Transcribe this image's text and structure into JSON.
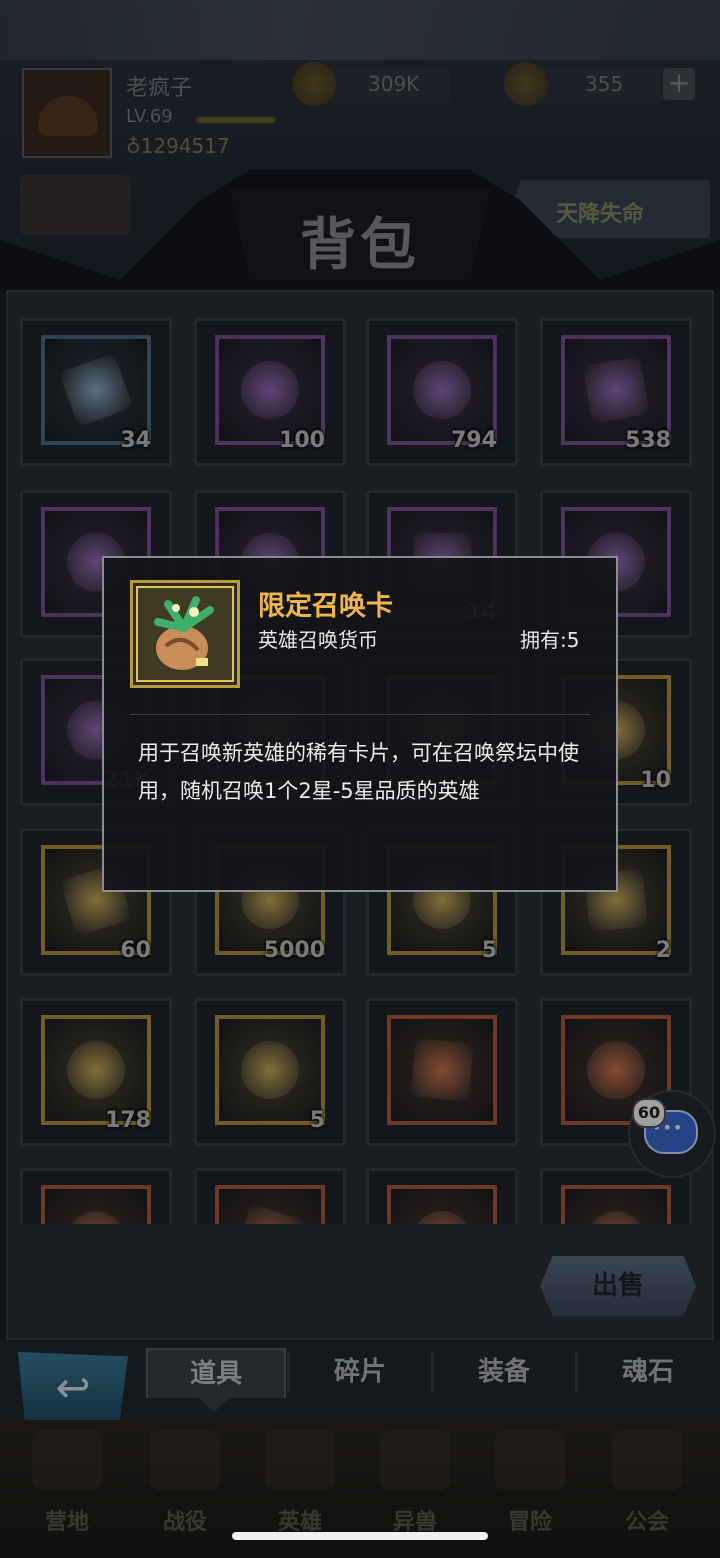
{
  "player": {
    "name": "老疯子",
    "level": "LV.69",
    "power": "1294517"
  },
  "resources": [
    {
      "icon": "gold-coin-icon",
      "value": "309K"
    },
    {
      "icon": "gem-icon",
      "value": "355"
    }
  ],
  "plus_label": "+",
  "event": {
    "label": "天降失命"
  },
  "title": "背包",
  "items": [
    {
      "icon": "blue-crystal-icon",
      "count": "34",
      "rarity": "blue"
    },
    {
      "icon": "gold-ore-shard-icon",
      "count": "100",
      "rarity": "purple"
    },
    {
      "icon": "stone-ore-icon",
      "count": "794",
      "rarity": "purple"
    },
    {
      "icon": "purple-crystal-icon",
      "count": "538",
      "rarity": "purple"
    },
    {
      "icon": "scroll-icon",
      "count": "",
      "rarity": "purple"
    },
    {
      "icon": "feather-crystal-icon",
      "count": "",
      "rarity": "purple"
    },
    {
      "icon": "dark-crystal-icon",
      "count": "14",
      "rarity": "purple"
    },
    {
      "icon": "card-deck-icon",
      "count": "",
      "rarity": "purple"
    },
    {
      "icon": "red-stone-icon",
      "count": "21K",
      "rarity": "purple"
    },
    {
      "icon": "blue-orb-icon",
      "count": "",
      "rarity": "gold"
    },
    {
      "icon": "spiral-shell-icon",
      "count": "",
      "rarity": "gold"
    },
    {
      "icon": "rune-stone-icon",
      "count": "10",
      "rarity": "gold"
    },
    {
      "icon": "helmet-crest-icon",
      "count": "60",
      "rarity": "gold"
    },
    {
      "icon": "blue-essence-icon",
      "count": "5000",
      "rarity": "gold"
    },
    {
      "icon": "summon-scroll-icon",
      "count": "5",
      "rarity": "gold"
    },
    {
      "icon": "treasure-chest-icon",
      "count": "2",
      "rarity": "gold"
    },
    {
      "icon": "gold-potion-icon",
      "count": "178",
      "rarity": "gold"
    },
    {
      "icon": "pink-potion-icon",
      "count": "5",
      "rarity": "gold"
    },
    {
      "icon": "banner-scroll-icon",
      "count": "",
      "rarity": "red"
    },
    {
      "icon": "hero-card-icon",
      "count": "",
      "rarity": "red"
    },
    {
      "icon": "blue-shard-icon",
      "count": "",
      "rarity": "red"
    },
    {
      "icon": "ice-shard-icon",
      "count": "",
      "rarity": "red"
    },
    {
      "icon": "frost-gem-icon",
      "count": "",
      "rarity": "red"
    },
    {
      "icon": "horn-icon",
      "count": "",
      "rarity": "red"
    }
  ],
  "tooltip": {
    "name": "限定召唤卡",
    "type": "英雄召唤货币",
    "owned": "拥有:5",
    "description": "用于召唤新英雄的稀有卡片，可在召唤祭坛中使用，随机召唤1个2星-5星品质的英雄",
    "icon": "summon-scroll-icon"
  },
  "sell_label": "出售",
  "chat_badge": "60",
  "tabs": [
    {
      "label": "道具",
      "active": true
    },
    {
      "label": "碎片",
      "active": false
    },
    {
      "label": "装备",
      "active": false
    },
    {
      "label": "魂石",
      "active": false
    }
  ],
  "nav": [
    {
      "label": "营地",
      "icon": "camp-icon"
    },
    {
      "label": "战役",
      "icon": "crossed-swords-icon"
    },
    {
      "label": "英雄",
      "icon": "hero-helmet-icon"
    },
    {
      "label": "异兽",
      "icon": "beast-icon"
    },
    {
      "label": "冒险",
      "icon": "compass-icon"
    },
    {
      "label": "公会",
      "icon": "guild-icon"
    }
  ],
  "colors": {
    "rarity_blue": "#4b6f8c",
    "rarity_purple": "#7d4f9a",
    "rarity_gold": "#b5953a",
    "rarity_red": "#b35b3a",
    "tooltip_title": "#f0b64a"
  }
}
